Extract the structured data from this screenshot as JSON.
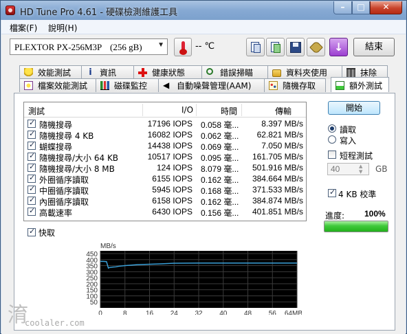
{
  "window": {
    "title": "HD Tune Pro 4.61 - 硬碟檢測維護工具"
  },
  "menu": {
    "file": "檔案(F)",
    "help": "說明(H)"
  },
  "drive": {
    "name": "PLEXTOR PX-256M3P",
    "size": "(256 gB)"
  },
  "temperature": "-- ℃",
  "toolbar": {
    "exit_label": "結束"
  },
  "tabs_row1": [
    "效能測試",
    "資訊",
    "健康狀態",
    "錯誤掃瞄",
    "資料夾使用",
    "抹除"
  ],
  "tabs_row2": [
    "檔案效能測試",
    "磁碟監控",
    "自動噪聲管理(AAM)",
    "隨機存取",
    "額外測試"
  ],
  "results": {
    "headers": {
      "test": "測試",
      "io": "I/O",
      "time": "時間",
      "speed": "傳輸"
    },
    "rows": [
      {
        "name": "隨機搜尋",
        "io": "17196 IOPS",
        "time": "0.058 毫...",
        "speed": "8.397 MB/s"
      },
      {
        "name": "隨機搜尋 4 KB",
        "io": "16082 IOPS",
        "time": "0.062 毫...",
        "speed": "62.821 MB/s"
      },
      {
        "name": "蝴蝶搜尋",
        "io": "14438 IOPS",
        "time": "0.069 毫...",
        "speed": "7.050 MB/s"
      },
      {
        "name": "隨機搜尋/大小 64 KB",
        "io": "10517 IOPS",
        "time": "0.095 毫...",
        "speed": "161.705 MB/s"
      },
      {
        "name": "隨機搜尋/大小 8 MB",
        "io": "124 IOPS",
        "time": "8.079 毫...",
        "speed": "501.916 MB/s"
      },
      {
        "name": "外圈循序讀取",
        "io": "6155 IOPS",
        "time": "0.162 毫...",
        "speed": "384.664 MB/s"
      },
      {
        "name": "中圈循序讀取",
        "io": "5945 IOPS",
        "time": "0.168 毫...",
        "speed": "371.533 MB/s"
      },
      {
        "name": "內圈循序讀取",
        "io": "6158 IOPS",
        "time": "0.162 毫...",
        "speed": "384.874 MB/s"
      },
      {
        "name": "高載速率",
        "io": "6430 IOPS",
        "time": "0.156 毫...",
        "speed": "401.851 MB/s"
      }
    ]
  },
  "cache_label": "快取",
  "controls": {
    "start_label": "開始",
    "read_label": "讀取",
    "write_label": "寫入",
    "short_test_label": "短程測試",
    "short_test_value": "40",
    "gb_label": "GB",
    "verify_label": "4 KB 校準",
    "progress_label": "進度:",
    "progress_value": "100%",
    "progress_fraction": 1.0
  },
  "chart_data": {
    "type": "line",
    "ylabel": "MB/s",
    "y_ticks": [
      "450",
      "400",
      "350",
      "300",
      "250",
      "200",
      "150",
      "100",
      "50"
    ],
    "x_ticks": [
      "0",
      "8",
      "16",
      "24",
      "32",
      "40",
      "48",
      "56",
      "64MB"
    ],
    "xlim": [
      0,
      64
    ],
    "ylim": [
      0,
      450
    ],
    "grid": true,
    "series": [
      {
        "color": "#3aa0d8",
        "x": [
          0,
          1,
          2,
          2.6,
          3,
          4,
          5,
          6,
          8,
          12,
          16,
          20,
          24,
          32,
          40,
          48,
          56,
          64
        ],
        "y": [
          385,
          385,
          383,
          330,
          335,
          338,
          340,
          345,
          350,
          358,
          362,
          365,
          370,
          372,
          372,
          372,
          372,
          372
        ]
      }
    ]
  },
  "watermark": {
    "char": "淯",
    "text": "coolaler.com"
  }
}
